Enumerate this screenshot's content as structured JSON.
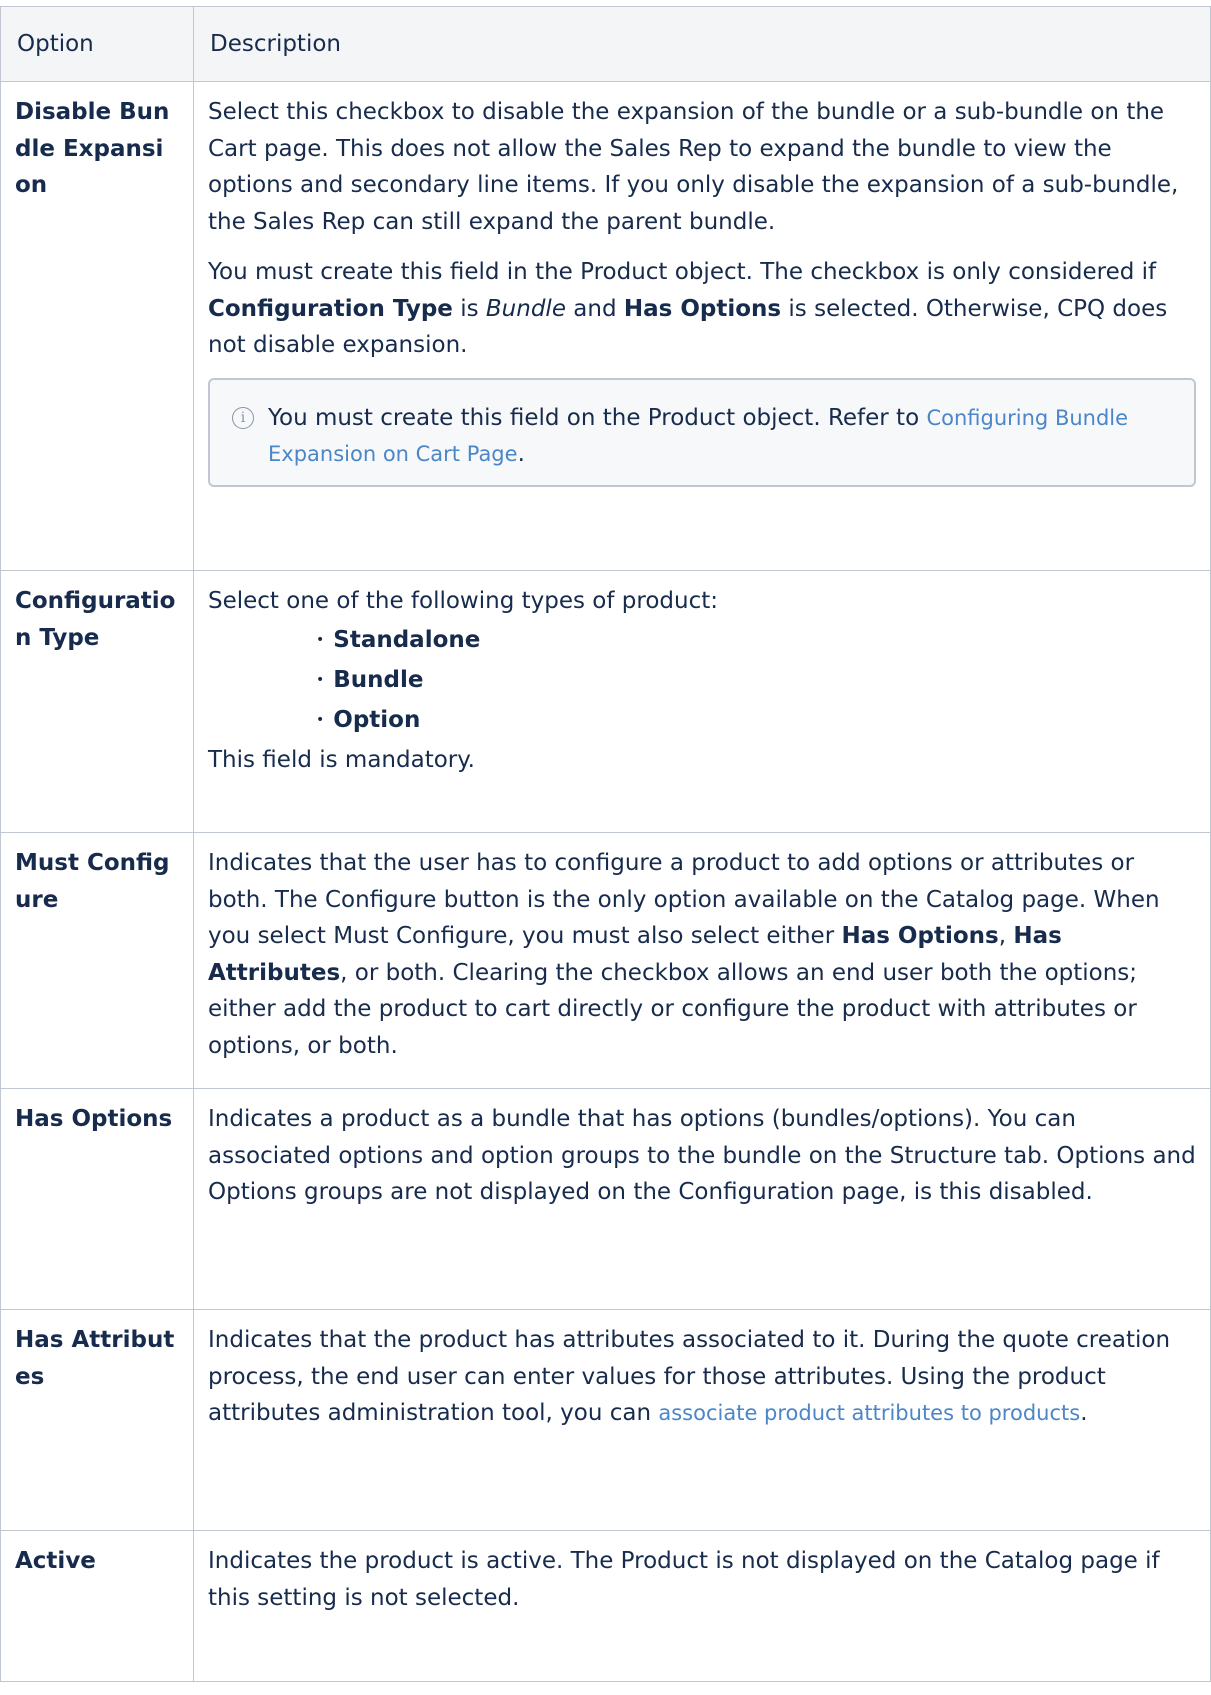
{
  "table": {
    "headers": {
      "option": "Option",
      "description": "Description"
    },
    "rows": [
      {
        "option": "Disable Bundle Expansion",
        "p1": "Select this checkbox to disable the expansion of the bundle or a sub-bundle on the Cart page. This does not allow the Sales Rep to expand the bundle to view the options and secondary line items. If you only disable the expansion of a sub-bundle, the Sales Rep can still expand the parent bundle.",
        "p2_a": "You must create this field in the Product object. The checkbox is only considered if ",
        "p2_b": "Configuration Type",
        "p2_c": " is ",
        "p2_d": "Bundle",
        "p2_e": " and ",
        "p2_f": "Has Options",
        "p2_g": " is selected. Otherwise, CPQ does not disable expansion.",
        "note_text": "You must create this field on the Product object. Refer to ",
        "note_link": "Configuring Bundle Expansion on Cart Page",
        "note_end": "."
      },
      {
        "option": "Configuration Type",
        "intro": "Select one of the following types of product:",
        "items": [
          "Standalone",
          "Bundle",
          "Option"
        ],
        "outro": "This field is mandatory."
      },
      {
        "option": "Must Configure",
        "a": "Indicates that the user has to configure a product to add options or attributes or both. The Configure button is the only option available on the Catalog page. When you select Must Configure, you must also select either ",
        "b": "Has Options",
        "c": ", ",
        "d": "Has Attributes",
        "e": ", or both. Clearing the checkbox allows an end user both the options; either add the product to cart directly or configure the product with attributes or options, or both."
      },
      {
        "option": "Has Options",
        "text": "Indicates a product as a bundle that has options (bundles/options). You can associated options and option groups to the bundle on the Structure tab. Options and Options groups are not displayed on the Configuration page, is this disabled."
      },
      {
        "option": "Has Attributes",
        "text": "Indicates that the product has attributes associated to it. During the quote creation process, the end user can enter values for those attributes. Using the product attributes administration tool, you can ",
        "link": "associate product attributes to products",
        "end": "."
      },
      {
        "option": "Active",
        "text": "Indicates the product is active. The Product is not displayed on the Catalog page if this setting is not selected."
      }
    ]
  },
  "colors": {
    "border": "#c1c7d0",
    "header_bg": "#f4f5f7",
    "text": "#172b4d",
    "link": "#4a86c8"
  },
  "icons": {
    "note": "info-icon"
  }
}
